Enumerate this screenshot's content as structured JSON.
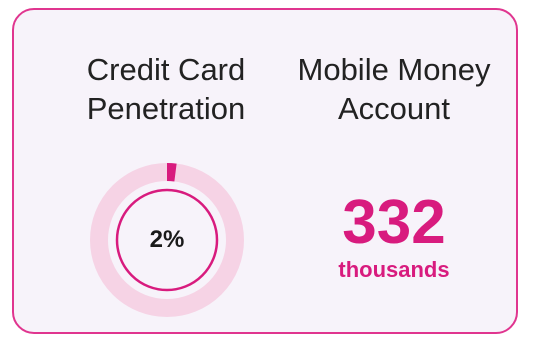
{
  "card": {
    "left_metric": {
      "title": "Credit Card\nPenetration",
      "value_label": "2%",
      "percent": 2
    },
    "right_metric": {
      "title": "Mobile Money\nAccount",
      "value": "332",
      "unit": "thousands"
    }
  },
  "colors": {
    "accent": "#d81b7e",
    "border": "#e0358f",
    "ring_track": "#f6d3e5",
    "inner_circle": "#d81b7e",
    "card_bg": "#f7f3fa"
  }
}
